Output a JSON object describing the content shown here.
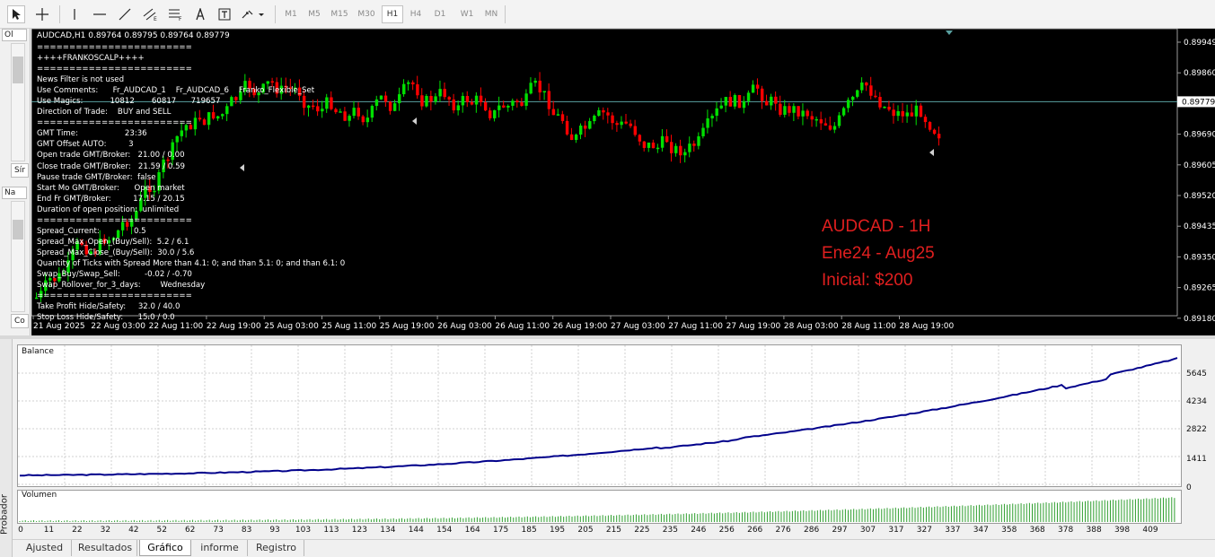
{
  "toolbar": {
    "timeframes": [
      {
        "label": "M1",
        "active": false
      },
      {
        "label": "M5",
        "active": false
      },
      {
        "label": "M15",
        "active": false
      },
      {
        "label": "M30",
        "active": false
      },
      {
        "label": "H1",
        "active": true
      },
      {
        "label": "H4",
        "active": false
      },
      {
        "label": "D1",
        "active": false
      },
      {
        "label": "W1",
        "active": false
      },
      {
        "label": "MN",
        "active": false
      }
    ]
  },
  "left_panel": {
    "tab1": "Ol",
    "tab2": "Na",
    "tab3": "Sír",
    "tab4": "Co"
  },
  "chart": {
    "symbol_line": "AUDCAD,H1  0.89764 0.89795 0.89764 0.89779",
    "info_lines": [
      "========================",
      "++++FRANKOSCALP++++",
      "========================",
      "News Filter is not used",
      "Use Comments:      Fr_AUDCAD_1    Fr_AUDCAD_6    Franko_Flexible_Set",
      "Use Magics:           10812       60817      719657",
      "Direction of Trade:    BUY and SELL",
      "========================",
      "GMT Time:                   23:36",
      "GMT Offset AUTO:         3",
      "Open trade GMT/Broker:   21.00 / 0.00",
      "Close trade GMT/Broker:   21.59 / 0.59",
      "Pause trade GMT/Broker:  false",
      "Start Mo GMT/Broker:      Open market",
      "End Fr GMT/Broker:         17.15 / 20.15",
      "Duration of open position:  unlimited",
      "========================",
      "Spread_Current:              0.5",
      "Spread_Max_Open_(Buy/Sell):  5.2 / 6.1",
      "Spread_Max_Close_(Buy/Sell):  30.0 / 5.6",
      "Quantity of Ticks with Spread More than 4.1: 0; and than 5.1: 0; and than 6.1: 0",
      "Swap_Buy/Swap_Sell:          -0.02 / -0.70",
      "Swap_Rollover_for_3_days:        Wednesday",
      "========================",
      "Take Profit Hide/Safety:     32.0 / 40.0",
      "Stop Loss Hide/Safety:      15.0 / 0.0"
    ],
    "overlay": {
      "line1": "AUDCAD - 1H",
      "line2": "Ene24 - Aug25",
      "line3": "Inicial: $200"
    },
    "price_labels": [
      "0.89949",
      "0.89860",
      "0.89779",
      "0.89690",
      "0.89605",
      "0.89520",
      "0.89435",
      "0.89350",
      "0.89265",
      "0.89180"
    ],
    "time_labels": [
      "21 Aug 2025",
      "22 Aug 03:00",
      "22 Aug 11:00",
      "22 Aug 19:00",
      "25 Aug 03:00",
      "25 Aug 11:00",
      "25 Aug 19:00",
      "26 Aug 03:00",
      "26 Aug 11:00",
      "26 Aug 19:00",
      "27 Aug 03:00",
      "27 Aug 11:00",
      "27 Aug 19:00",
      "28 Aug 03:00",
      "28 Aug 11:00",
      "28 Aug 19:00"
    ],
    "colors": {
      "bull": "#00e000",
      "bear": "#ff0000",
      "current_price": "#5aa0a0"
    }
  },
  "tester": {
    "side_label": "Probador",
    "balance_label": "Balance",
    "volume_label": "Volumen",
    "balance_axis": [
      "5645",
      "4234",
      "2822",
      "1411",
      "0"
    ],
    "x_axis": [
      "0",
      "11",
      "22",
      "32",
      "42",
      "52",
      "62",
      "73",
      "83",
      "93",
      "103",
      "113",
      "123",
      "134",
      "144",
      "154",
      "164",
      "175",
      "185",
      "195",
      "205",
      "215",
      "225",
      "235",
      "246",
      "256",
      "266",
      "276",
      "286",
      "297",
      "307",
      "317",
      "327",
      "337",
      "347",
      "358",
      "368",
      "378",
      "388",
      "398",
      "409"
    ],
    "tabs": [
      {
        "label": "Ajusted",
        "active": false
      },
      {
        "label": "Resultados",
        "active": false
      },
      {
        "label": "Gráfico",
        "active": true
      },
      {
        "label": "informe",
        "active": false
      },
      {
        "label": "Registro",
        "active": false
      }
    ],
    "balance_color": "#00008b",
    "volume_color": "#2e9e2e"
  }
}
